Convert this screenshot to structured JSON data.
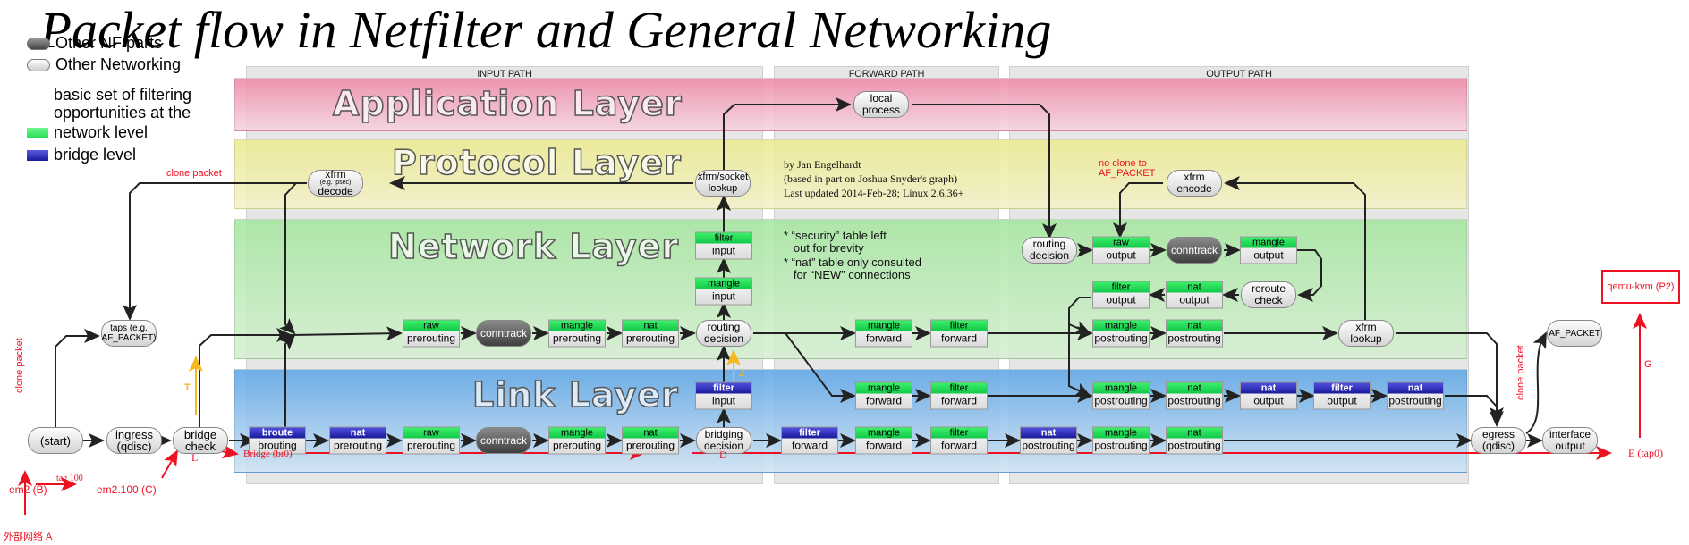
{
  "title": "Packet flow in Netfilter and General Networking",
  "legend": {
    "other_nf": "Other NF parts",
    "other_net": "Other Networking",
    "basic_set": "basic set of filtering",
    "opportunities": "opportunities at the",
    "network_level": "network level",
    "bridge_level": "bridge level",
    "colors": {
      "network": "#22dd55",
      "bridge": "#2a2ab0"
    }
  },
  "paths": {
    "input": "INPUT PATH",
    "forward": "FORWARD PATH",
    "output": "OUTPUT PATH"
  },
  "layers": {
    "application": "Application Layer",
    "protocol": "Protocol Layer",
    "network": "Network Layer",
    "link": "Link Layer"
  },
  "credits": {
    "line1": "by Jan Engelhardt",
    "line2": "(based in part on Joshua Snyder's graph)",
    "line3": "Last updated 2014-Feb-28; Linux 2.6.36+"
  },
  "footnotes": {
    "line1": "* “security” table left",
    "line2": "   out for brevity",
    "line3": "* “nat” table only consulted",
    "line4": "   for “NEW” connections"
  },
  "nodes": {
    "start": "(start)",
    "ingress_1": "ingress",
    "ingress_2": "(qdisc)",
    "bridge_check_1": "bridge",
    "bridge_check_2": "check",
    "taps_1": "taps (e.g.",
    "taps_2": "AF_PACKET)",
    "xfrm_decode_1": "xfrm",
    "xfrm_decode_sub": "(e.g. ipsec)",
    "xfrm_decode_2": "decode",
    "xfrm_socket_1": "xfrm/socket",
    "xfrm_socket_2": "lookup",
    "local_process_1": "local",
    "local_process_2": "process",
    "conntrack": "conntrack",
    "routing_1": "routing",
    "routing_2": "decision",
    "bridging_1": "bridging",
    "bridging_2": "decision",
    "xfrm_encode_1": "xfrm",
    "xfrm_encode_2": "encode",
    "reroute_1": "reroute",
    "reroute_2": "check",
    "xfrm_lookup_1": "xfrm",
    "xfrm_lookup_2": "lookup",
    "egress_1": "egress",
    "egress_2": "(qdisc)",
    "iface_1": "interface",
    "iface_2": "output",
    "af_packet": "AF_PACKET"
  },
  "chains": [
    {
      "id": "net-raw-pre",
      "table": "raw",
      "hook": "prerouting",
      "kind": "net"
    },
    {
      "id": "net-mangle-pre",
      "table": "mangle",
      "hook": "prerouting",
      "kind": "net"
    },
    {
      "id": "net-nat-pre",
      "table": "nat",
      "hook": "prerouting",
      "kind": "net"
    },
    {
      "id": "net-mangle-in",
      "table": "mangle",
      "hook": "input",
      "kind": "net"
    },
    {
      "id": "net-filter-in",
      "table": "filter",
      "hook": "input",
      "kind": "net"
    },
    {
      "id": "link-broute",
      "table": "broute",
      "hook": "brouting",
      "kind": "bridge"
    },
    {
      "id": "link-nat-pre",
      "table": "nat",
      "hook": "prerouting",
      "kind": "bridge"
    },
    {
      "id": "link-raw-pre",
      "table": "raw",
      "hook": "prerouting",
      "kind": "net"
    },
    {
      "id": "link-mangle-pre",
      "table": "mangle",
      "hook": "prerouting",
      "kind": "net"
    },
    {
      "id": "link-nat-pre2",
      "table": "nat",
      "hook": "prerouting",
      "kind": "net"
    },
    {
      "id": "link-filter-in",
      "table": "filter",
      "hook": "input",
      "kind": "bridge"
    },
    {
      "id": "fwd-mangle-net",
      "table": "mangle",
      "hook": "forward",
      "kind": "net"
    },
    {
      "id": "fwd-filter-net",
      "table": "filter",
      "hook": "forward",
      "kind": "net"
    },
    {
      "id": "fwd-mangle-l2",
      "table": "mangle",
      "hook": "forward",
      "kind": "net"
    },
    {
      "id": "fwd-filter-l2",
      "table": "filter",
      "hook": "forward",
      "kind": "net"
    },
    {
      "id": "fwd-filter-br",
      "table": "filter",
      "hook": "forward",
      "kind": "bridge"
    },
    {
      "id": "fwd-mangle-br",
      "table": "mangle",
      "hook": "forward",
      "kind": "net"
    },
    {
      "id": "fwd-filter-br2",
      "table": "filter",
      "hook": "forward",
      "kind": "net"
    },
    {
      "id": "out-raw",
      "table": "raw",
      "hook": "output",
      "kind": "net"
    },
    {
      "id": "out-mangle",
      "table": "mangle",
      "hook": "output",
      "kind": "net"
    },
    {
      "id": "out-filter",
      "table": "filter",
      "hook": "output",
      "kind": "net"
    },
    {
      "id": "out-nat",
      "table": "nat",
      "hook": "output",
      "kind": "net"
    },
    {
      "id": "out-mangle-post",
      "table": "mangle",
      "hook": "postrouting",
      "kind": "net"
    },
    {
      "id": "out-nat-post",
      "table": "nat",
      "hook": "postrouting",
      "kind": "net"
    },
    {
      "id": "l2-mangle-post",
      "table": "mangle",
      "hook": "postrouting",
      "kind": "net"
    },
    {
      "id": "l2-nat-post",
      "table": "nat",
      "hook": "postrouting",
      "kind": "net"
    },
    {
      "id": "l2-br-nat-out",
      "table": "nat",
      "hook": "output",
      "kind": "bridge"
    },
    {
      "id": "l2-br-filter-out",
      "table": "filter",
      "hook": "output",
      "kind": "bridge"
    },
    {
      "id": "l2-br-nat-post",
      "table": "nat",
      "hook": "postrouting",
      "kind": "bridge"
    },
    {
      "id": "br-nat-post",
      "table": "nat",
      "hook": "postrouting",
      "kind": "bridge"
    },
    {
      "id": "br-mangle-post",
      "table": "mangle",
      "hook": "postrouting",
      "kind": "net"
    },
    {
      "id": "br-nat-post2",
      "table": "nat",
      "hook": "postrouting",
      "kind": "net"
    }
  ],
  "annotations": {
    "clone_packet_top": "clone packet",
    "clone_packet_left": "clone packet",
    "clone_packet_right": "clone packet",
    "no_clone_1": "no clone to",
    "no_clone_2": "AF_PACKET",
    "em2": "em2 (B)",
    "tag100": "tag 100",
    "em2_100": "em2.100 (C)",
    "external": "外部网络 A",
    "L": "L",
    "bridge_br0": "Bridge (br0)",
    "D": "D",
    "E": "E (tap0)",
    "G": "G",
    "T": "T",
    "J": "J",
    "qemu": "qemu-kvm (P2)"
  }
}
